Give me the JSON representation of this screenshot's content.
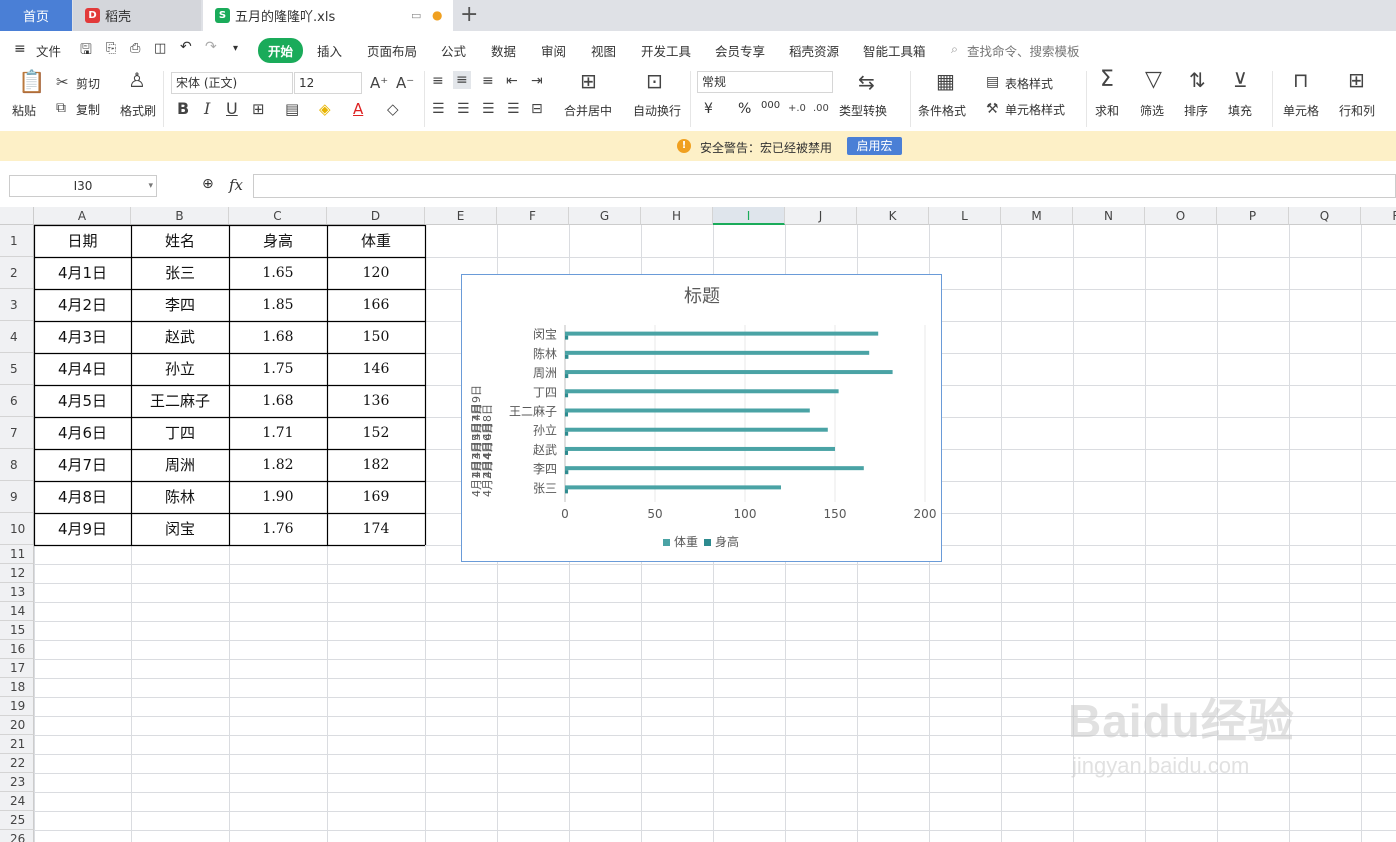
{
  "tabs": {
    "home": "首页",
    "daoke": "稻壳",
    "file": "五月的隆隆吖.xls"
  },
  "menu": [
    "文件",
    "开始",
    "插入",
    "页面布局",
    "公式",
    "数据",
    "审阅",
    "视图",
    "开发工具",
    "会员专享",
    "稻壳资源",
    "智能工具箱",
    "查找命令、搜索模板"
  ],
  "ribbon": {
    "paste": "粘贴",
    "cut": "剪切",
    "copy": "复制",
    "format_painter": "格式刷",
    "font_name": "宋体 (正文)",
    "font_size": "12",
    "merge_center": "合并居中",
    "wrap": "自动换行",
    "number_format": "常规",
    "currency": "¥",
    "percent": "%",
    "thousands": "000",
    "type_convert": "类型转换",
    "cond_format": "条件格式",
    "table_style": "表格样式",
    "cell_style": "单元格样式",
    "sum": "求和",
    "filter": "筛选",
    "sort": "排序",
    "fill": "填充",
    "cell": "单元格",
    "row_col": "行和列"
  },
  "warning": {
    "text": "安全警告：宏已经被禁用",
    "button": "启用宏"
  },
  "name_box": "I30",
  "fx_label": "fx",
  "columns": [
    "A",
    "B",
    "C",
    "D",
    "E",
    "F",
    "G",
    "H",
    "I",
    "J",
    "K",
    "L",
    "M",
    "N",
    "O",
    "P",
    "Q",
    "R"
  ],
  "selected_column": "I",
  "rows": [
    "1",
    "2",
    "3",
    "4",
    "5",
    "6",
    "7",
    "8",
    "9",
    "10",
    "11",
    "12",
    "13",
    "14",
    "15",
    "16",
    "17",
    "18",
    "19",
    "20",
    "21",
    "22",
    "23",
    "24",
    "25",
    "26"
  ],
  "table": {
    "headers": [
      "日期",
      "姓名",
      "身高",
      "体重"
    ],
    "rows": [
      [
        "4月1日",
        "张三",
        "1.65",
        "120"
      ],
      [
        "4月2日",
        "李四",
        "1.85",
        "166"
      ],
      [
        "4月3日",
        "赵武",
        "1.68",
        "150"
      ],
      [
        "4月4日",
        "孙立",
        "1.75",
        "146"
      ],
      [
        "4月5日",
        "王二麻子",
        "1.68",
        "136"
      ],
      [
        "4月6日",
        "丁四",
        "1.71",
        "152"
      ],
      [
        "4月7日",
        "周洲",
        "1.82",
        "182"
      ],
      [
        "4月8日",
        "陈林",
        "1.90",
        "169"
      ],
      [
        "4月9日",
        "闵宝",
        "1.76",
        "174"
      ]
    ]
  },
  "chart_data": {
    "type": "bar",
    "orientation": "horizontal",
    "title": "标题",
    "categories": [
      "张三",
      "李四",
      "赵武",
      "孙立",
      "王二麻子",
      "丁四",
      "周洲",
      "陈林",
      "闵宝"
    ],
    "outer_axis_labels": [
      "4月1日",
      "4月2日",
      "4月3日",
      "4月4日",
      "4月5日",
      "4月6日",
      "4月7日",
      "4月8日",
      "4月9日"
    ],
    "series": [
      {
        "name": "体重",
        "values": [
          120,
          166,
          150,
          146,
          136,
          152,
          182,
          169,
          174
        ],
        "color": "#4aa3a5"
      },
      {
        "name": "身高",
        "values": [
          1.65,
          1.85,
          1.68,
          1.75,
          1.68,
          1.71,
          1.82,
          1.9,
          1.76
        ],
        "color": "#2e8b8f"
      }
    ],
    "xticks": [
      "0",
      "50",
      "100",
      "150",
      "200"
    ],
    "xlim": [
      0,
      200
    ],
    "legend_position": "bottom"
  },
  "watermark": {
    "brand": "Baidu经验",
    "url": "jingyan.baidu.com"
  }
}
